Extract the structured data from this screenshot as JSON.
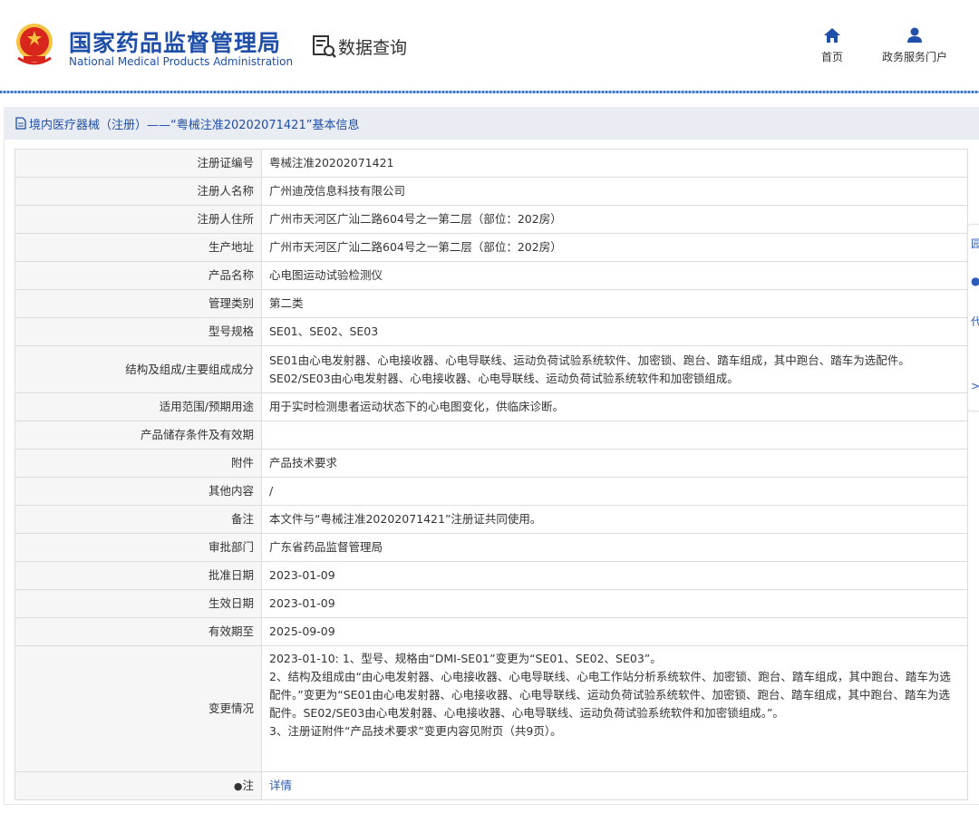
{
  "header": {
    "org_cn": "国家药品监督管理局",
    "org_en": "National Medical Products Administration",
    "query_title": "数据查询",
    "nav_home": "首页",
    "nav_portal": "政务服务门户",
    "brand_color": "#1f4fa8"
  },
  "breadcrumb": {
    "text": "境内医疗器械（注册）——“粤械注准20202071421”基本信息"
  },
  "side_tabs": [
    "园",
    "●",
    "代",
    ">"
  ],
  "rows": [
    {
      "label": "注册证编号",
      "value": "粤械注准20202071421"
    },
    {
      "label": "注册人名称",
      "value": "广州迪茂信息科技有限公司"
    },
    {
      "label": "注册人住所",
      "value": "广州市天河区广汕二路604号之一第二层（部位：202房）"
    },
    {
      "label": "生产地址",
      "value": "广州市天河区广汕二路604号之一第二层（部位：202房）"
    },
    {
      "label": "产品名称",
      "value": "心电图运动试验检测仪"
    },
    {
      "label": "管理类别",
      "value": "第二类"
    },
    {
      "label": "型号规格",
      "value": "SE01、SE02、SE03"
    },
    {
      "label": "结构及组成/主要组成成分",
      "value": "SE01由心电发射器、心电接收器、心电导联线、运动负荷试验系统软件、加密锁、跑台、踏车组成，其中跑台、踏车为选配件。",
      "value2": "SE02/SE03由心电发射器、心电接收器、心电导联线、运动负荷试验系统软件和加密锁组成。"
    },
    {
      "label": "适用范围/预期用途",
      "value": "用于实时检测患者运动状态下的心电图变化，供临床诊断。"
    },
    {
      "label": "产品储存条件及有效期",
      "value": ""
    },
    {
      "label": "附件",
      "value": "产品技术要求"
    },
    {
      "label": "其他内容",
      "value": "/"
    },
    {
      "label": "备注",
      "value": "本文件与“粤械注准20202071421”注册证共同使用。"
    },
    {
      "label": "审批部门",
      "value": "广东省药品监督管理局"
    },
    {
      "label": "批准日期",
      "value": "2023-01-09"
    },
    {
      "label": "生效日期",
      "value": "2023-01-09"
    },
    {
      "label": "有效期至",
      "value": "2025-09-09"
    }
  ],
  "change": {
    "label": "变更情况",
    "lines": [
      "2023-01-10: 1、型号、规格由“DMI-SE01”变更为“SE01、SE02、SE03”。",
      "2、结构及组成由“由心电发射器、心电接收器、心电导联线、心电工作站分析系统软件、加密锁、跑台、踏车组成，其中跑台、踏车为选配件。”变更为“SE01由心电发射器、心电接收器、心电导联线、运动负荷试验系统软件、加密锁、跑台、踏车组成，其中跑台、踏车为选配件。SE02/SE03由心电发射器、心电接收器、心电导联线、运动负荷试验系统软件和加密锁组成。”。",
      "3、注册证附件“产品技术要求”变更内容见附页（共9页）。"
    ]
  },
  "note": {
    "label": "注",
    "link": "详情"
  }
}
